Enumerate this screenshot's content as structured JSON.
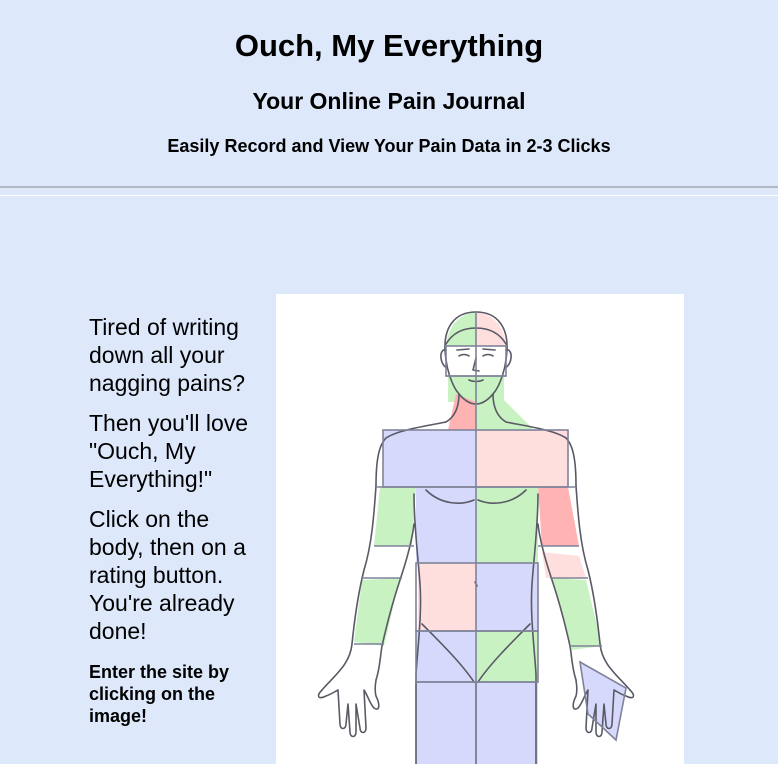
{
  "header": {
    "title": "Ouch, My Everything",
    "subtitle": "Your Online Pain Journal",
    "tagline": "Easily Record and View Your Pain Data in 2-3 Clicks"
  },
  "intro": {
    "paragraph_1": "Tired of writing down all your nagging pains?",
    "paragraph_2": "Then you'll love \"Ouch, My Everything!\"",
    "paragraph_3": "Click on the body, then on a rating button. You're already done!",
    "enter_note": "Enter the site by clicking on the image!"
  },
  "body_map": {
    "icon": "human-body-outline-icon",
    "colors": {
      "green": "#c9f2c2",
      "red": "#ffb3b3",
      "pink": "#ffdede",
      "lavender": "#d6d9fb",
      "outline": "#5a5a66",
      "grid": "#7f8399"
    }
  }
}
